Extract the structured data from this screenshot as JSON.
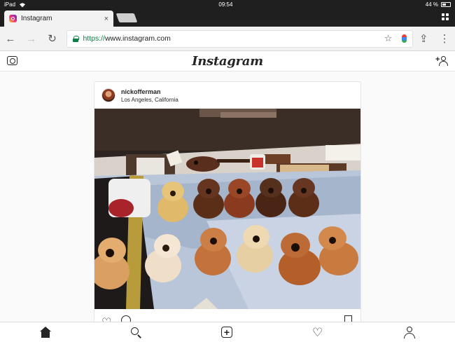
{
  "status_bar": {
    "device": "iPad",
    "time": "09:54",
    "battery": "44 %"
  },
  "browser": {
    "tab": {
      "title": "Instagram",
      "close": "×"
    },
    "omnibox": {
      "scheme": "https://",
      "host": "www.instagram.com"
    }
  },
  "instagram": {
    "logo": "Instagram",
    "post": {
      "username": "nickofferman",
      "location": "Los Angeles, California",
      "photo_subject": "ukulele-bodies-on-workbench"
    }
  },
  "icons": {
    "back": "←",
    "forward": "→",
    "reload": "↻",
    "star": "☆",
    "share": "⇪",
    "menu": "⋮",
    "heart": "♡",
    "wifi": "wifi-icon"
  },
  "colors": {
    "secure_green": "#0b8043",
    "ig_text": "#262626",
    "chrome_dark": "#1f1f1f"
  }
}
